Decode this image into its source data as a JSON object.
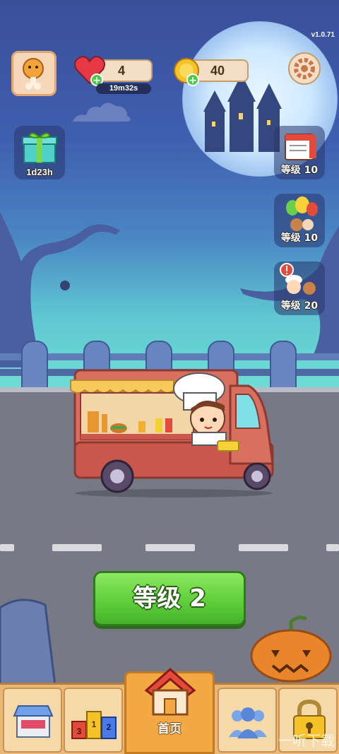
{
  "version": "v1.0.71",
  "hud": {
    "lives_value": "4",
    "lives_timer": "19m32s",
    "coins_value": "40"
  },
  "gift": {
    "timer": "1d23h"
  },
  "side_buttons": [
    {
      "label": "等级 10",
      "icon": "calendar-icon"
    },
    {
      "label": "等级 10",
      "icon": "balloons-icon"
    },
    {
      "label": "等级 20",
      "icon": "customers-alert-icon"
    }
  ],
  "level_button": {
    "label": "等级 2"
  },
  "nav": {
    "items": [
      {
        "icon": "shop-icon"
      },
      {
        "icon": "podium-icon",
        "ranks": [
          "3",
          "1",
          "2"
        ]
      },
      {
        "icon": "home-icon",
        "label": "首页"
      },
      {
        "icon": "friends-icon"
      },
      {
        "icon": "lock-icon"
      }
    ]
  },
  "watermark": "一听下载",
  "colors": {
    "level_button": "#5fcf3a",
    "nav_bar": "#e9b877",
    "home_tab": "#f2a843"
  }
}
